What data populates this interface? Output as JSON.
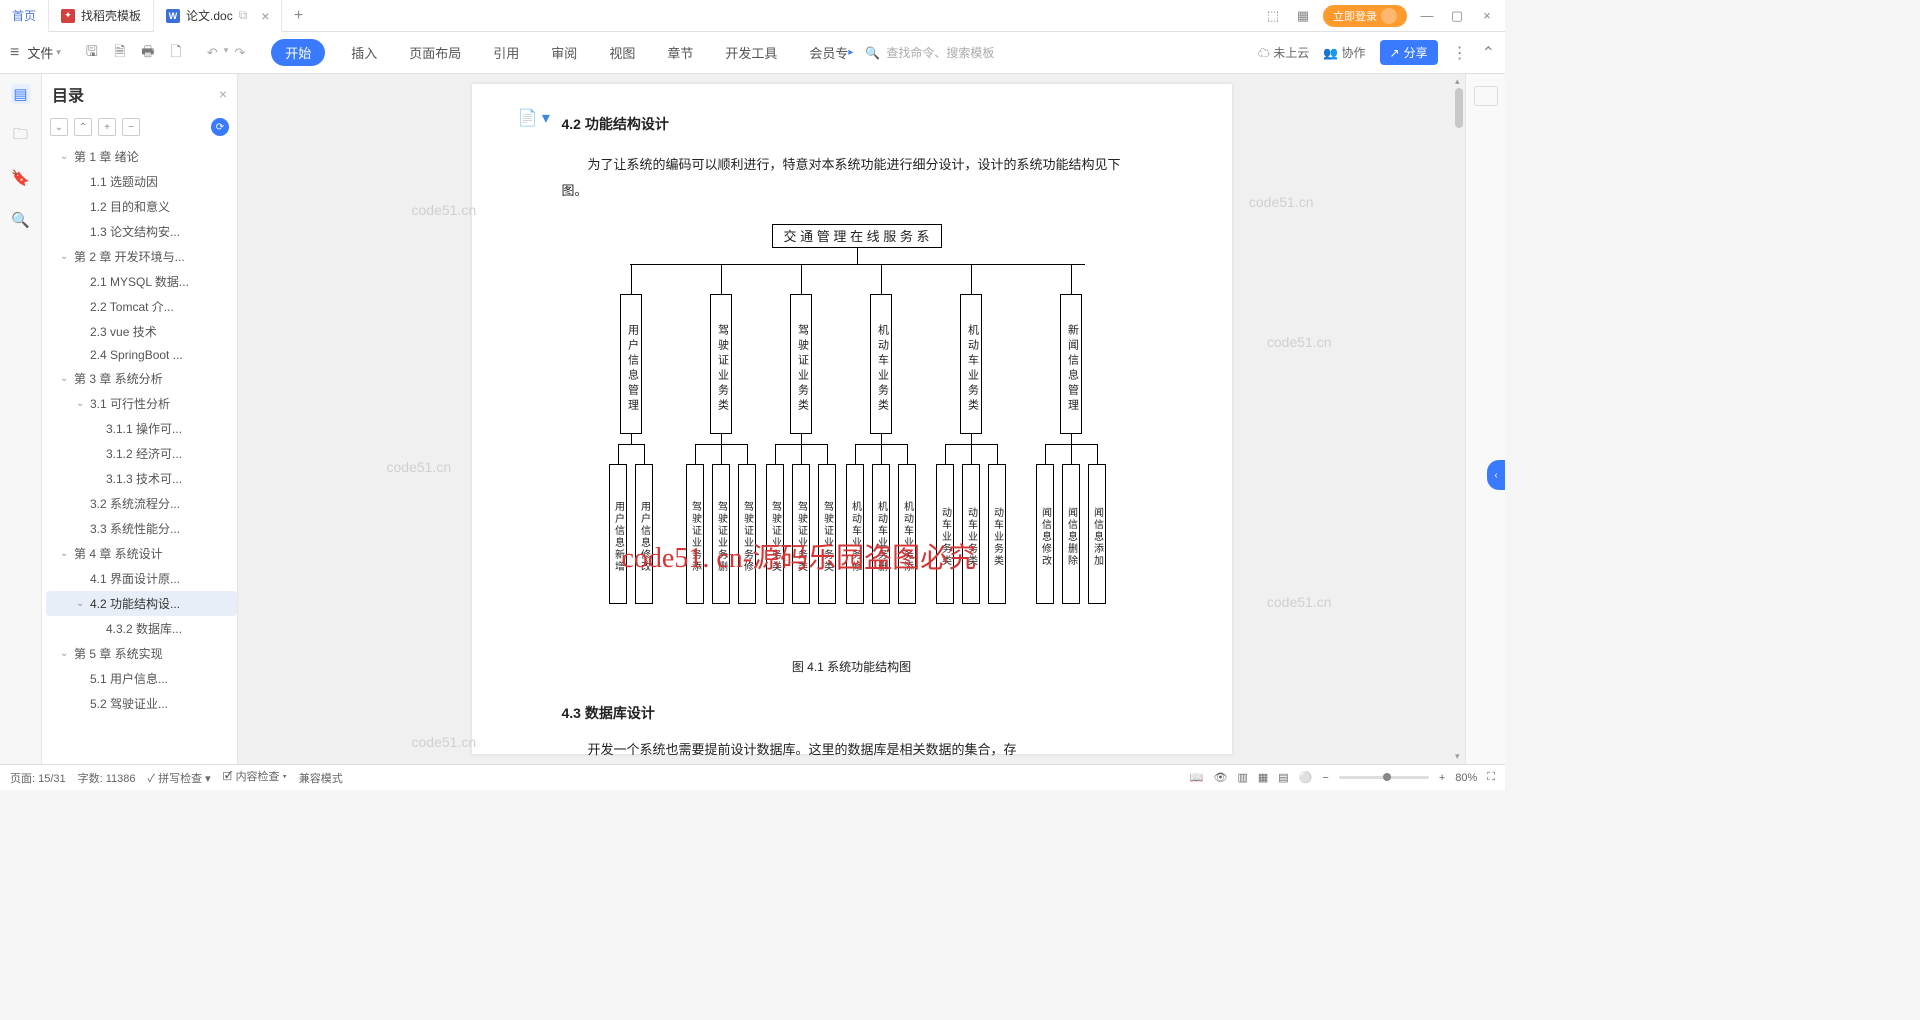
{
  "tabs": {
    "home": "首页",
    "t1": "找稻壳模板",
    "t2": "论文.doc"
  },
  "login": "立即登录",
  "file_menu": "文件",
  "ribbon": {
    "start": "开始",
    "insert": "插入",
    "layout": "页面布局",
    "ref": "引用",
    "review": "审阅",
    "view": "视图",
    "chapter": "章节",
    "dev": "开发工具",
    "member": "会员专"
  },
  "search_ph": "查找命令、搜索模板",
  "tb_right": {
    "cloud": "未上云",
    "collab": "协作",
    "share": "分享"
  },
  "outline_title": "目录",
  "tree": [
    {
      "t": "第 1 章  绪论",
      "l": 1,
      "c": 1
    },
    {
      "t": "1.1 选题动因",
      "l": 2
    },
    {
      "t": "1.2 目的和意义",
      "l": 2
    },
    {
      "t": "1.3 论文结构安...",
      "l": 2
    },
    {
      "t": "第 2 章  开发环境与...",
      "l": 1,
      "c": 1
    },
    {
      "t": "2.1 MYSQL 数据...",
      "l": 2
    },
    {
      "t": "2.2 Tomcat  介...",
      "l": 2
    },
    {
      "t": "2.3 vue 技术",
      "l": 2
    },
    {
      "t": "2.4 SpringBoot ...",
      "l": 2
    },
    {
      "t": "第 3 章  系统分析",
      "l": 1,
      "c": 1
    },
    {
      "t": "3.1 可行性分析",
      "l": 2,
      "c": 1
    },
    {
      "t": "3.1.1 操作可...",
      "l": 3
    },
    {
      "t": "3.1.2 经济可...",
      "l": 3
    },
    {
      "t": "3.1.3 技术可...",
      "l": 3
    },
    {
      "t": "3.2 系统流程分...",
      "l": 2
    },
    {
      "t": "3.3 系统性能分...",
      "l": 2
    },
    {
      "t": "第 4 章  系统设计",
      "l": 1,
      "c": 1
    },
    {
      "t": "4.1 界面设计原...",
      "l": 2
    },
    {
      "t": "4.2 功能结构设...",
      "l": 2,
      "c": 1,
      "sel": 1
    },
    {
      "t": "4.3.2  数据库...",
      "l": 3
    },
    {
      "t": "第 5 章  系统实现",
      "l": 1,
      "c": 1
    },
    {
      "t": "5.1 用户信息...",
      "l": 2
    },
    {
      "t": "5.2 驾驶证业...",
      "l": 2
    }
  ],
  "doc": {
    "h42": "4.2 功能结构设计",
    "p1": "为了让系统的编码可以顺利进行，特意对本系统功能进行细分设计，设计的系统功能结构见下图。",
    "root": "交 通 管 理 在 线 服 务 系",
    "l2": [
      "用户信息管理",
      "驾驶证业务类",
      "驾驶证业务类",
      "机动车业务类",
      "机动车业务类",
      "新闻信息管理"
    ],
    "l3": [
      "用户信息新增",
      "用户信息修改",
      "驾驶证业务添",
      "驾驶证业务删",
      "驾驶证业务修",
      "驾驶证业务类",
      "驾驶证业务类",
      "驾驶证业务类",
      "机动车业务修",
      "机动车业务删",
      "机动车业务添",
      "动车业务类",
      "动车业务类",
      "动车业务类",
      "闻信息修改",
      "闻信息删除",
      "闻信息添加"
    ],
    "cap": "图 4.1  系统功能结构图",
    "h43": "4.3  数据库设计",
    "p2": "开发一个系统也需要提前设计数据库。这里的数据库是相关数据的集合，存"
  },
  "wm_red": "code51. cn-源码乐园盗图必究",
  "wm": "code51.cn",
  "status": {
    "page": "页面: 15/31",
    "words": "字数: 11386",
    "spell": "拼写检查",
    "content": "内容检查",
    "compat": "兼容模式",
    "zoom": "80%"
  }
}
